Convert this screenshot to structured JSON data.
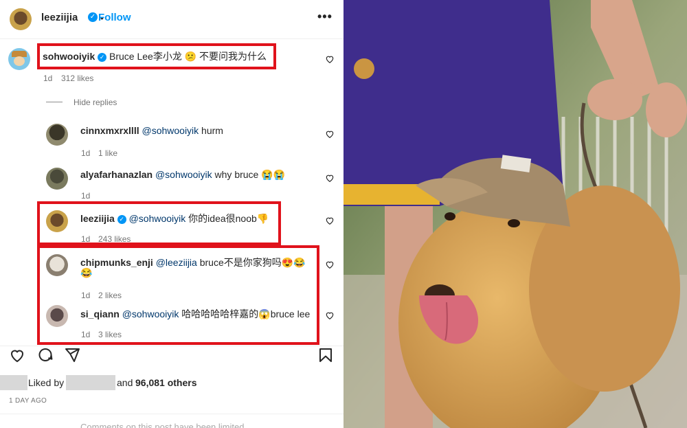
{
  "header": {
    "username": "leeziijia",
    "separator": "•",
    "follow_label": "Follow",
    "more_icon": "more-icon"
  },
  "main_comment": {
    "username": "sohwooiyik",
    "text": "Bruce Lee李小龙 😕 不要问我为什么",
    "age": "1d",
    "likes": "312 likes"
  },
  "hide_replies": "Hide replies",
  "replies": [
    {
      "username": "cinnxmxrxllll",
      "mention": "@sohwooiyik",
      "text": " hurm",
      "age": "1d",
      "likes": "1 like"
    },
    {
      "username": "alyafarhanazlan",
      "mention": "@sohwooiyik",
      "text": " why bruce 😭😭",
      "age": "1d",
      "likes": ""
    },
    {
      "username": "leeziijia",
      "mention": "@sohwooiyik",
      "text": " 你的idea很noob👎",
      "age": "1d",
      "likes": "243 likes"
    },
    {
      "username": "chipmunks_enji",
      "mention": "@leeziijia",
      "text": " bruce不是你家狗吗😍😂",
      "text2": "😂",
      "age": "1d",
      "likes": "2 likes"
    },
    {
      "username": "si_qiann",
      "mention": "@sohwooiyik",
      "text": " 哈哈哈哈哈梓嘉的😱bruce lee",
      "age": "1d",
      "likes": "3 likes"
    }
  ],
  "actions": {
    "like_icon": "heart-icon",
    "comment_icon": "comment-icon",
    "share_icon": "share-icon",
    "save_icon": "bookmark-icon"
  },
  "liked_by": {
    "prefix": "Liked by",
    "middle": "and",
    "count": "96,081 others"
  },
  "timestamp": "1 DAY AGO",
  "footer_text": "Comments on this post have been limited",
  "colors": {
    "follow": "#0095f6",
    "red_box": "#e0121b",
    "verified": "#0095f6"
  }
}
